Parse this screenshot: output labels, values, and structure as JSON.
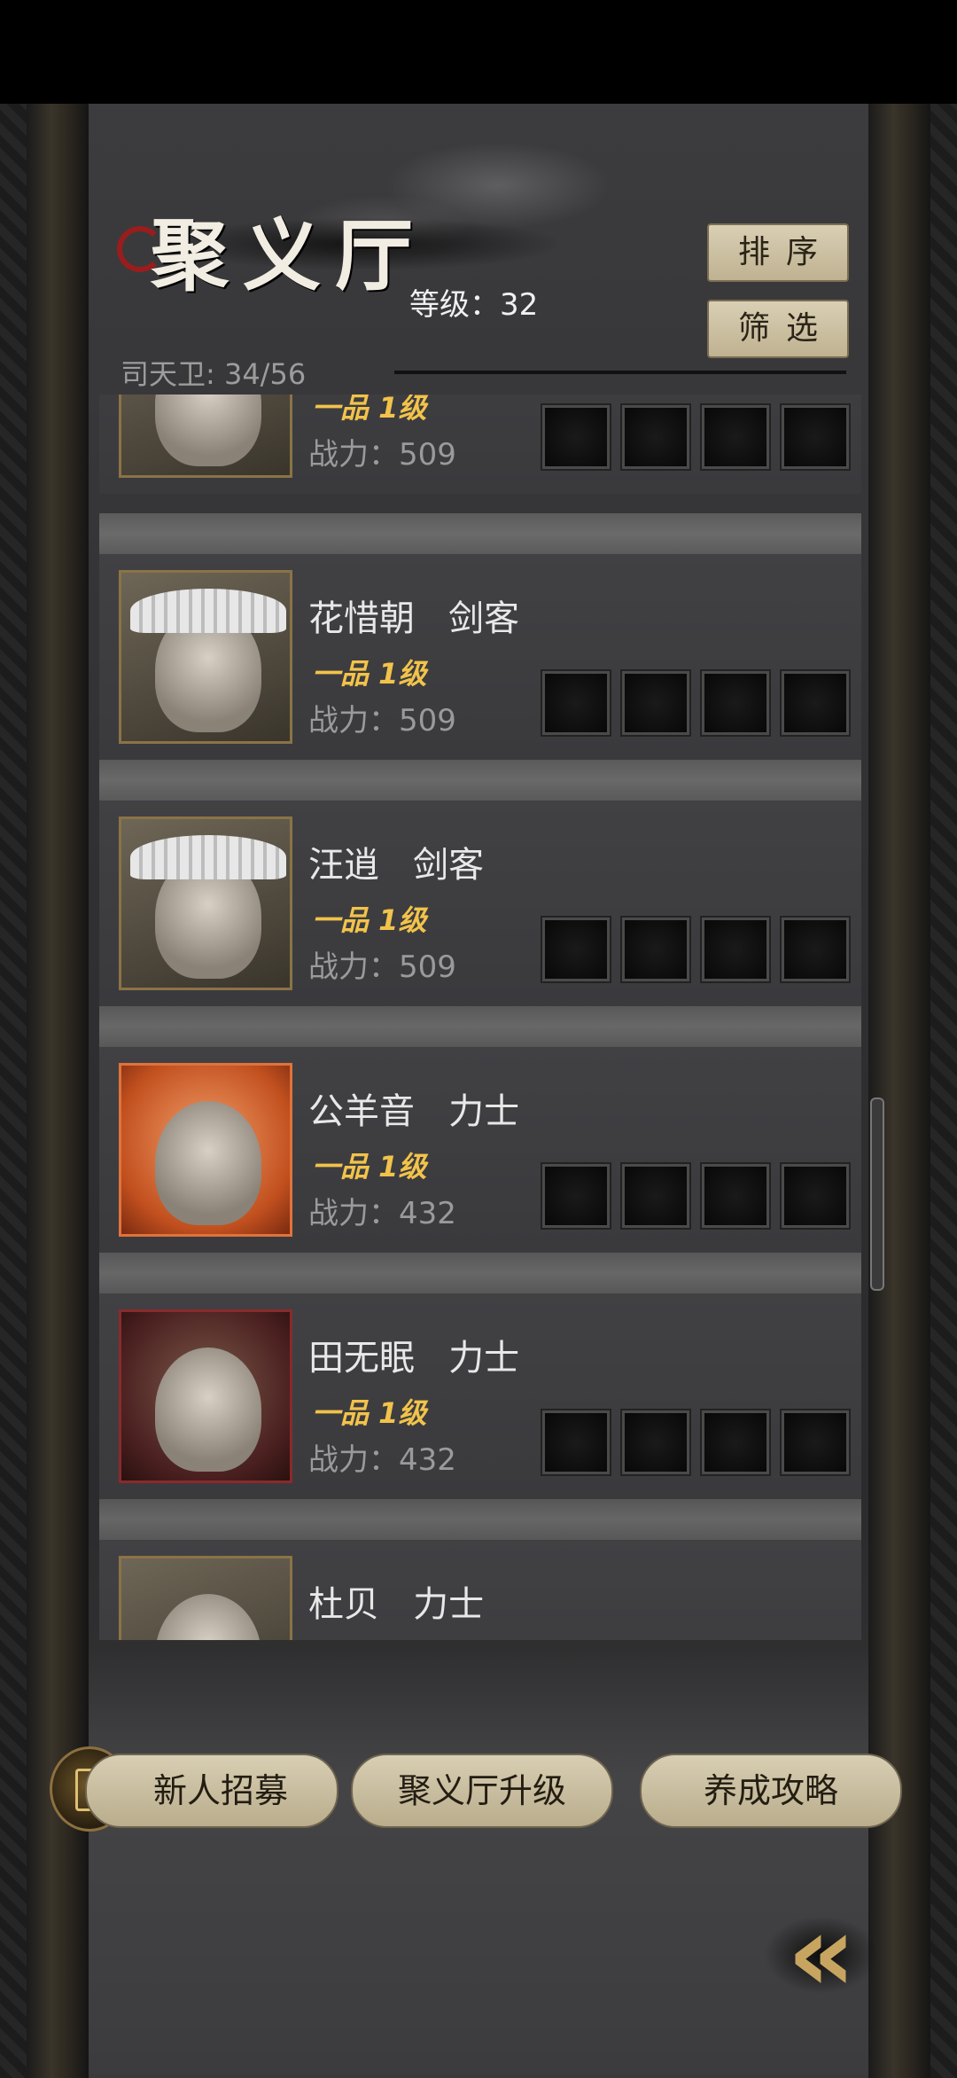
{
  "header": {
    "title": "聚义厅",
    "level": "等级：32",
    "member_count": "司天卫: 34/56",
    "sort_label": "排序",
    "filter_label": "筛选"
  },
  "heroes": [
    {
      "name": "",
      "rank": "一品 1级",
      "power": "战力：509",
      "portrait": "black-cap-swordsman"
    },
    {
      "name": "花惜朝   剑客",
      "rank": "一品 1级",
      "power": "战力：509",
      "portrait": "straw-hat-swordsman"
    },
    {
      "name": "汪逍   剑客",
      "rank": "一品 1级",
      "power": "战力：509",
      "portrait": "straw-hat-swordsman"
    },
    {
      "name": "公羊音   力士",
      "rank": "一品 1级",
      "power": "战力：432",
      "portrait": "orange-girl"
    },
    {
      "name": "田无眠   力士",
      "rank": "一品 1级",
      "power": "战力：432",
      "portrait": "hooded-man"
    },
    {
      "name": "杜贝   力士",
      "rank": "",
      "power": "",
      "portrait": "armored-man"
    }
  ],
  "bottom_bar": {
    "recruit_label": "新人招募",
    "upgrade_label": "聚义厅升级",
    "guide_label": "养成攻略"
  },
  "back_glyph": "«",
  "colors": {
    "rank_gold": "#f2c34b",
    "button_beige": "#d8ceb3",
    "panel_gray": "#3a3a3d"
  }
}
